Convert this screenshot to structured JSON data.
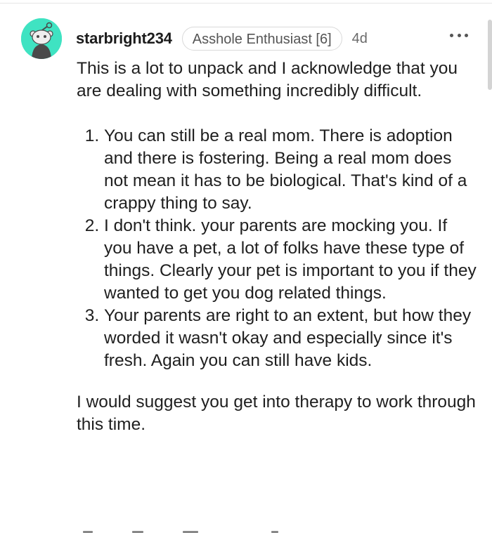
{
  "comment": {
    "username": "starbright234",
    "flair": "Asshole Enthusiast [6]",
    "time": "4d",
    "intro": "This is a lot to unpack and I acknowledge that you are dealing with something incredibly difficult.",
    "points": [
      "You can still be a real mom. There is adoption and there is fostering. Being a real mom does not mean it has to be biological. That's kind of a crappy thing to say.",
      "I don't think. your parents are mocking you. If you have a pet, a lot of folks have these type of things. Clearly your pet is important to you if they wanted to get you dog related things.",
      "Your parents are right to an extent, but how they worded it wasn't okay and especially since it's fresh. Again you can still have kids."
    ],
    "outro": "I would suggest you get into therapy to work through this time."
  },
  "icons": {
    "avatar": "reddit-snoo-avatar-icon",
    "more": "more-options-icon"
  },
  "colors": {
    "avatar_bg": "#3fe3c2",
    "text": "#1f1f1f"
  }
}
